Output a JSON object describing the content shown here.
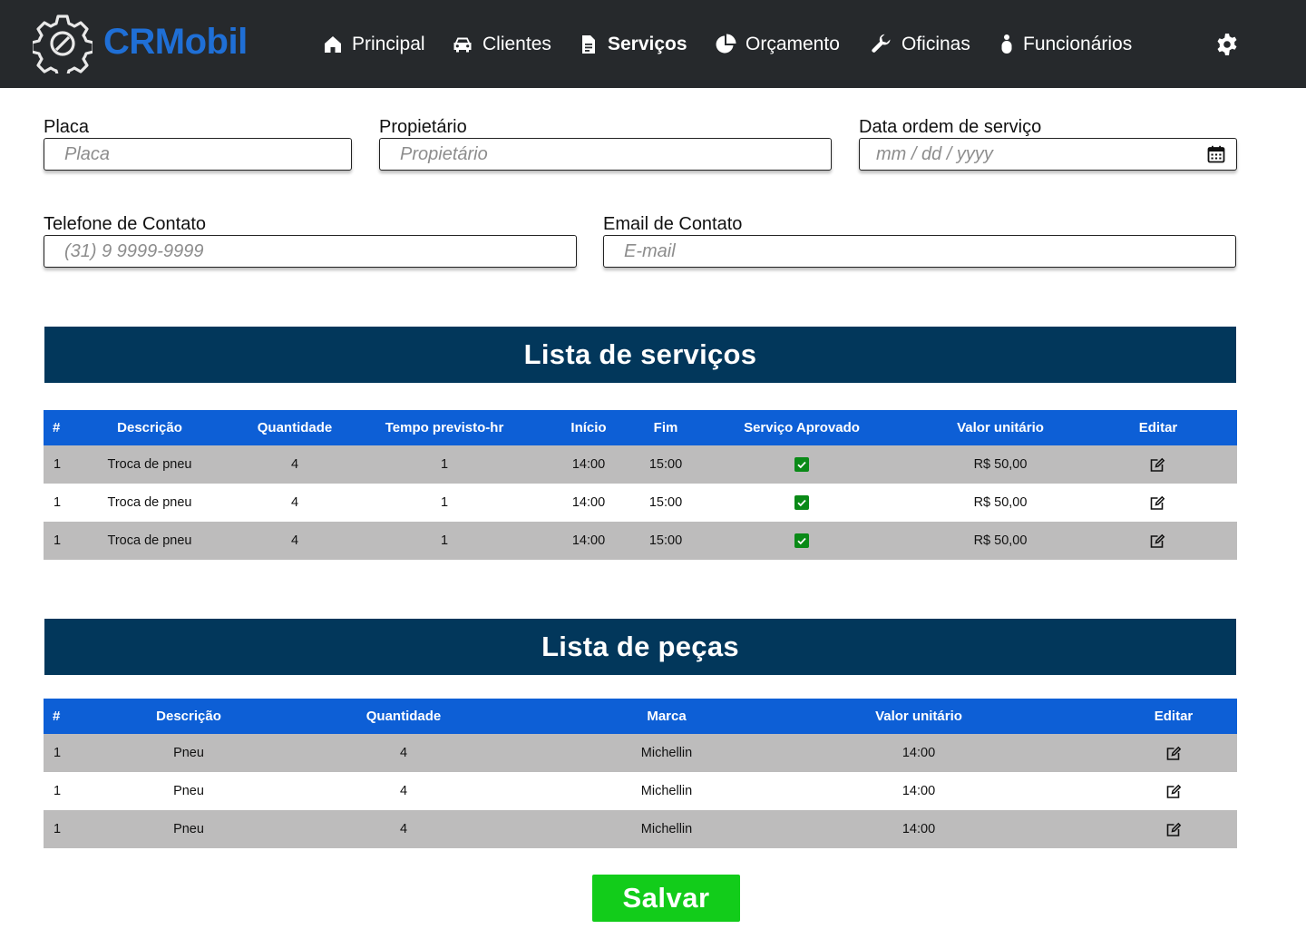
{
  "nav": {
    "brand": "CRMobil",
    "items": [
      {
        "label": "Principal",
        "icon": "home-icon"
      },
      {
        "label": "Clientes",
        "icon": "car-icon"
      },
      {
        "label": "Serviços",
        "icon": "document-icon",
        "active": true
      },
      {
        "label": "Orçamento",
        "icon": "pie-chart-icon"
      },
      {
        "label": "Oficinas",
        "icon": "wrench-icon"
      },
      {
        "label": "Funcionários",
        "icon": "person-icon"
      }
    ],
    "settings_icon": "gear-icon"
  },
  "form": {
    "placa": {
      "label": "Placa",
      "placeholder": "Placa",
      "value": ""
    },
    "proprietario": {
      "label": "Propietário",
      "placeholder": "Propietário",
      "value": ""
    },
    "data_ordem": {
      "label": "Data ordem de serviço",
      "placeholder": "mm / dd / yyyy",
      "value": ""
    },
    "telefone": {
      "label": "Telefone de Contato",
      "placeholder": "(31) 9 9999-9999",
      "value": ""
    },
    "email": {
      "label": "Email de Contato",
      "placeholder": "E-mail",
      "value": ""
    }
  },
  "servicos": {
    "title": "Lista de serviços",
    "columns": [
      "#",
      "Descrição",
      "Quantidade",
      "Tempo previsto-hr",
      "Início",
      "Fim",
      "Serviço Aprovado",
      "Valor unitário",
      "Editar"
    ],
    "rows": [
      {
        "id": "1",
        "descricao": "Troca de pneu",
        "quantidade": "4",
        "tempo": "1",
        "inicio": "14:00",
        "fim": "15:00",
        "aprovado": true,
        "valor": "R$ 50,00"
      },
      {
        "id": "1",
        "descricao": "Troca de pneu",
        "quantidade": "4",
        "tempo": "1",
        "inicio": "14:00",
        "fim": "15:00",
        "aprovado": true,
        "valor": "R$ 50,00"
      },
      {
        "id": "1",
        "descricao": "Troca de pneu",
        "quantidade": "4",
        "tempo": "1",
        "inicio": "14:00",
        "fim": "15:00",
        "aprovado": true,
        "valor": "R$ 50,00"
      }
    ]
  },
  "pecas": {
    "title": "Lista de peças",
    "columns": [
      "#",
      "Descrição",
      "Quantidade",
      "Marca",
      "Valor unitário",
      "Editar"
    ],
    "rows": [
      {
        "id": "1",
        "descricao": "Pneu",
        "quantidade": "4",
        "marca": "Michellin",
        "valor": "14:00"
      },
      {
        "id": "1",
        "descricao": "Pneu",
        "quantidade": "4",
        "marca": "Michellin",
        "valor": "14:00"
      },
      {
        "id": "1",
        "descricao": "Pneu",
        "quantidade": "4",
        "marca": "Michellin",
        "valor": "14:00"
      }
    ]
  },
  "actions": {
    "save_label": "Salvar"
  },
  "colors": {
    "navbar": "#26292c",
    "brand": "#1f6fd6",
    "section_header": "#02375b",
    "table_header": "#0d5fd6",
    "row_shade": "#bdbcbc",
    "check": "#0a8a17",
    "save_button": "#12cc1a"
  }
}
